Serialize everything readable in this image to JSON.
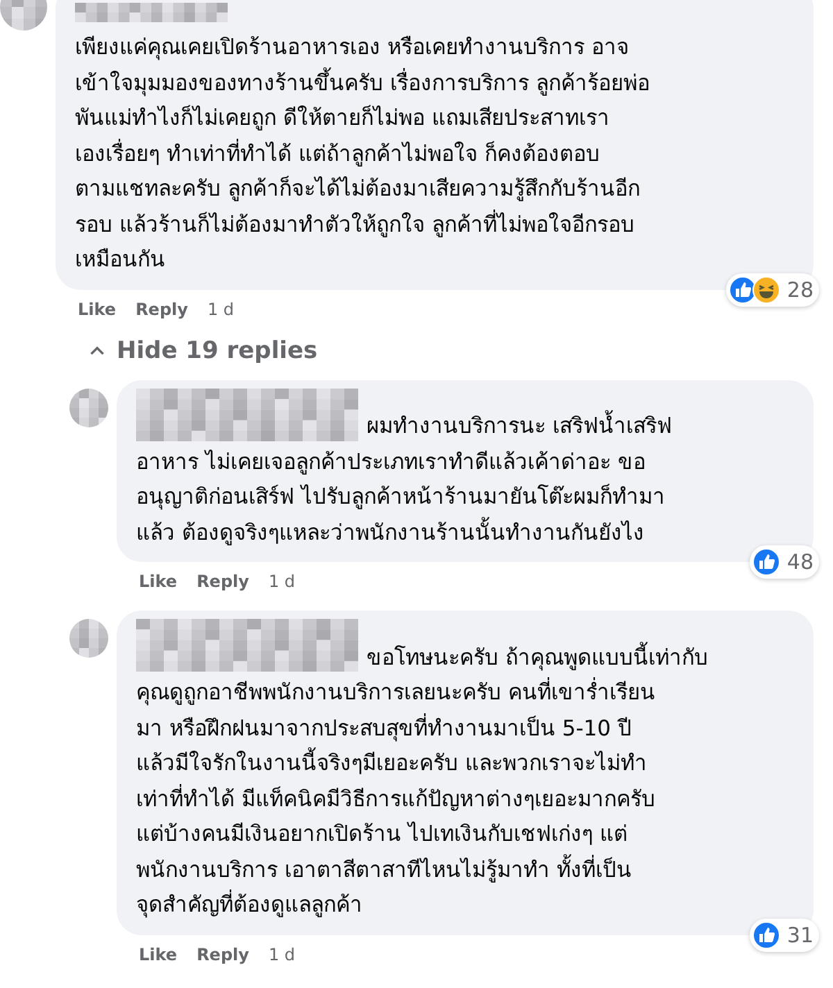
{
  "comments": [
    {
      "lines": [
        "เพียงแค่คุณเคยเปิดร้านอาหารเอง หรือเคยทำงานบริการ อาจ",
        "เข้าใจมุมมองของทางร้านขึ้นครับ เรื่องการบริการ ลูกค้าร้อยพ่อ",
        "พันแม่ทำไงก็ไม่เคยถูก ดีให้ตายก็ไม่พอ แถมเสียประสาทเรา",
        "เองเรื่อยๆ ทำเท่าที่ทำได้ แต่ถ้าลูกค้าไม่พอใจ ก็คงต้องตอบ",
        "ตามแชทละครับ ลูกค้าก็จะได้ไม่ต้องมาเสียความรู้สึกกับร้านอีก",
        "รอบ แล้วร้านก็ไม่ต้องมาทำตัวให้ถูกใจ ลูกค้าที่ไม่พอใจอีกรอบ",
        "เหมือนกัน"
      ],
      "reactions": [
        {
          "kind": "like"
        },
        {
          "kind": "haha"
        }
      ],
      "reaction_count": "28",
      "like": "Like",
      "reply": "Reply",
      "time": "1 d",
      "toggle": {
        "label": "Hide 19 replies"
      },
      "replies": [
        {
          "lines": [
            "ผมทำงานบริการนะ เสริฟน้ำเสริฟ",
            "อาหาร ไม่เคยเจอลูกค้าประเภทเราทำดีแล้วเค้าด่าอะ ขอ",
            "อนุญาติก่อนเสิร์ฟ ไปรับลูกค้าหน้าร้านมายันโต๊ะผมก็ทำมา",
            "แล้ว ต้องดูจริงๆแหละว่าพนักงานร้านนั้นทำงานกันยังไง"
          ],
          "reactions": [
            {
              "kind": "like"
            }
          ],
          "reaction_count": "48",
          "like": "Like",
          "reply": "Reply",
          "time": "1 d"
        },
        {
          "lines": [
            "ขอโทษนะครับ ถ้าคุณพูดแบบนี้เท่ากับ",
            "คุณดูถูกอาชีพพนักงานบริการเลยนะครับ คนที่เขาร่ำเรียน",
            "มา หรือฝึกฝนมาจากประสบสุขที่ทำงานมาเป็น 5-10 ปี",
            "แล้วมีใจรักในงานนี้จริงๆมีเยอะครับ และพวกเราจะไม่ทำ",
            "เท่าที่ทำได้ มีแท็คนิคมีวิธีการแก้ปัญหาต่างๆเยอะมากครับ",
            "แต่บ้างคนมีเงินอยากเปิดร้าน ไปเทเงินกับเชฟเก่งๆ แต่",
            "พนักงานบริการ เอาตาสีตาสาทีไหนไม่รู้มาทำ ทั้งที่เป็น",
            "จุดสำคัญที่ต้องดูแลลูกค้า"
          ],
          "reactions": [
            {
              "kind": "like"
            }
          ],
          "reaction_count": "31",
          "like": "Like",
          "reply": "Reply",
          "time": "1 d"
        }
      ]
    }
  ]
}
